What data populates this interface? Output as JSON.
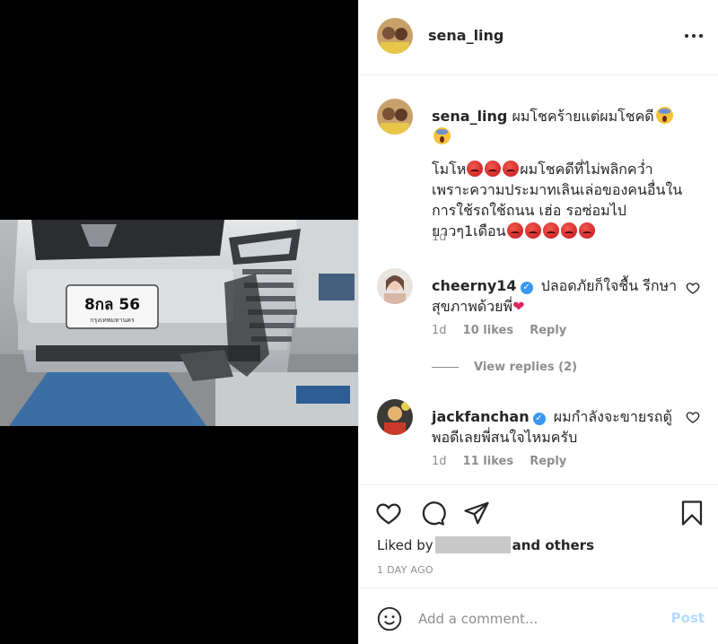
{
  "post": {
    "username": "sena_ling",
    "more_icon": "more-horizontal-icon"
  },
  "photo": {
    "plate_number": "8กล 56",
    "plate_province": "กรุงเทพมหานคร"
  },
  "caption": {
    "username": "sena_ling",
    "headline": "ผมโชคร้ายแต่ผมโชคดี",
    "line1_prefix": "โมโห",
    "line1_suffix": "ผมโชคดีที่ไม่พลิกคว่ำ",
    "line2": "เพราะความประมาทเลินเล่อของคนอื่นใน",
    "line3": "การใช้รถใช้ถนน เฮ่อ รอซ่อมไป",
    "line4": "ยาวๆ1เดือน",
    "age": "1d"
  },
  "comments": [
    {
      "username": "cheerny14",
      "line1": "ปลอดภัยก็ใจชื้น รีกษา",
      "line2": "สุขภาพด้วยพี่",
      "age": "1d",
      "likes": "10 likes",
      "reply": "Reply"
    },
    {
      "username": "jackfanchan",
      "line1": "ผมกำลังจะขายรถตู้",
      "line2": "พอดีเลยพี่สนใจไหมครับ",
      "age": "1d",
      "likes": "11 likes",
      "reply": "Reply"
    }
  ],
  "view_replies": "View replies (2)",
  "actions": {
    "icons": [
      "heart-icon",
      "comment-icon",
      "share-icon",
      "bookmark-icon"
    ],
    "liked_prefix": "Liked by",
    "liked_suffix": "and others",
    "date": "1 DAY AGO"
  },
  "add_comment": {
    "placeholder": "Add a comment...",
    "post_label": "Post"
  },
  "colors": {
    "link_blue": "#3897f0",
    "post_disabled": "#b3dbff",
    "muted": "#8e8e8e"
  }
}
